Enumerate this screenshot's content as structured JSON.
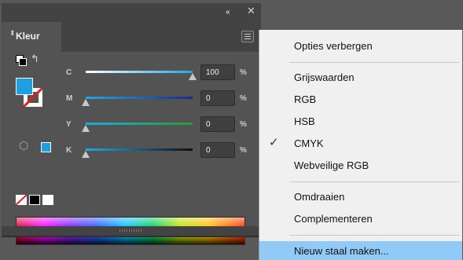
{
  "window": {
    "collapse_icon": "«",
    "close_icon": "✕"
  },
  "panel": {
    "tab_label": "Kleur",
    "tab_arrows": "⬍",
    "swap_icon": "↰",
    "cube_icon": "⬡"
  },
  "colors": {
    "fill": "#1e9fe0",
    "highlight": "#91c9f7"
  },
  "sliders": [
    {
      "label": "C",
      "value": "100",
      "unit": "%",
      "level": 1.0
    },
    {
      "label": "M",
      "value": "0",
      "unit": "%",
      "level": 0.0
    },
    {
      "label": "Y",
      "value": "0",
      "unit": "%",
      "level": 0.0
    },
    {
      "label": "K",
      "value": "0",
      "unit": "%",
      "level": 0.0
    }
  ],
  "menu": {
    "items": [
      {
        "label": "Opties verbergen",
        "checked": false
      },
      {
        "label": "Grijswaarden",
        "checked": false
      },
      {
        "label": "RGB",
        "checked": false
      },
      {
        "label": "HSB",
        "checked": false
      },
      {
        "label": "CMYK",
        "checked": true,
        "check": "✓"
      },
      {
        "label": "Webveilige RGB",
        "checked": false
      },
      {
        "label": "Omdraaien",
        "checked": false
      },
      {
        "label": "Complementeren",
        "checked": false
      },
      {
        "label": "Nieuw staal maken...",
        "checked": false,
        "highlighted": true
      }
    ]
  }
}
